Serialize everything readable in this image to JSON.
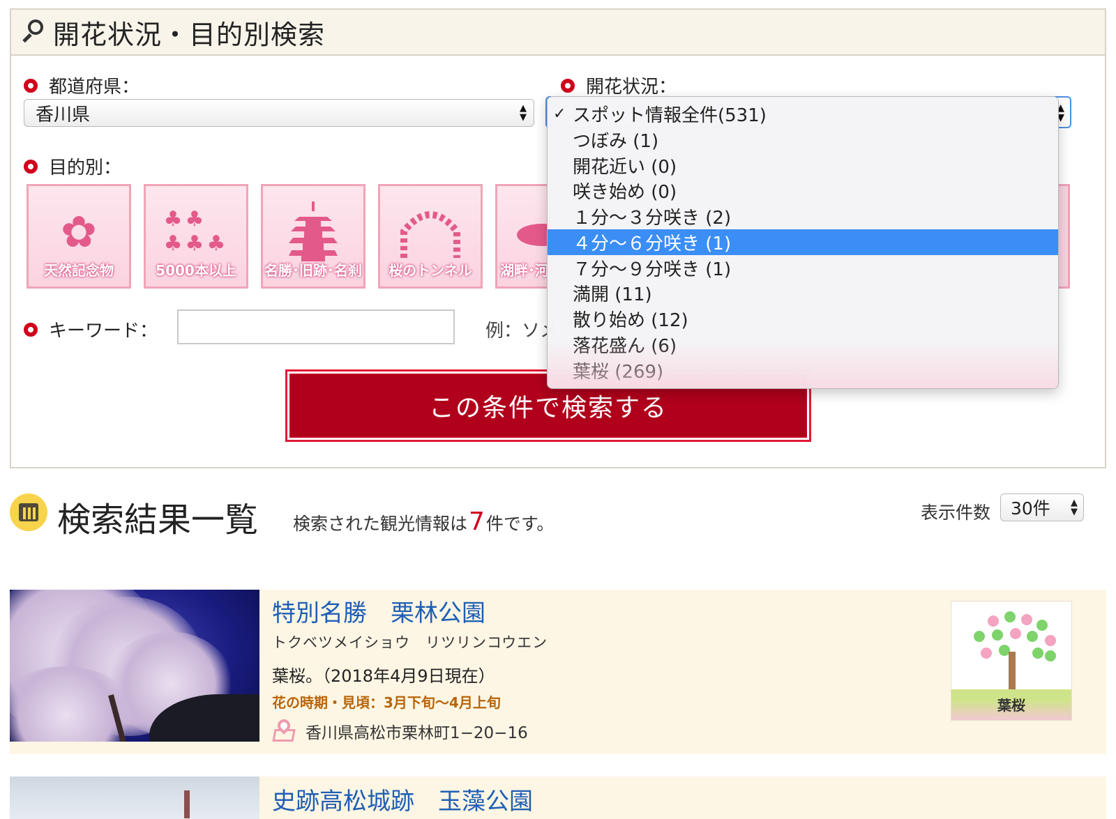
{
  "search_panel": {
    "title": "開花状況・目的別検索",
    "prefecture_label": "都道府県：",
    "prefecture_value": "香川県",
    "bloom_label": "開花状況：",
    "purpose_label": "目的別：",
    "purpose_tiles": [
      {
        "label": "天然記念物",
        "icon": "sakura-flower-icon"
      },
      {
        "label": "5000本以上",
        "icon": "tree-cluster-icon"
      },
      {
        "label": "名勝･旧跡･名刹",
        "icon": "pagoda-icon"
      },
      {
        "label": "桜のトンネル",
        "icon": "sakura-arch-icon"
      },
      {
        "label": "湖畔･河",
        "icon": "lakeside-icon"
      }
    ],
    "keyword_label": "キーワード：",
    "keyword_value": "",
    "keyword_example": "例：ソメ",
    "search_button": "この条件で検索する"
  },
  "bloom_dropdown": {
    "options": [
      {
        "label": "スポット情報全件(531)",
        "checked": true,
        "highlighted": false
      },
      {
        "label": "つぼみ (1)",
        "checked": false,
        "highlighted": false
      },
      {
        "label": "開花近い (0)",
        "checked": false,
        "highlighted": false
      },
      {
        "label": "咲き始め (0)",
        "checked": false,
        "highlighted": false
      },
      {
        "label": "１分～３分咲き (2)",
        "checked": false,
        "highlighted": false
      },
      {
        "label": "４分～６分咲き (1)",
        "checked": false,
        "highlighted": true
      },
      {
        "label": "７分～９分咲き (1)",
        "checked": false,
        "highlighted": false
      },
      {
        "label": "満開 (11)",
        "checked": false,
        "highlighted": false
      },
      {
        "label": "散り始め (12)",
        "checked": false,
        "highlighted": false
      },
      {
        "label": "落花盛ん (6)",
        "checked": false,
        "highlighted": false
      },
      {
        "label": "葉桜 (269)",
        "checked": false,
        "highlighted": false
      }
    ],
    "check_mark": "✓",
    "highlight_color": "#3b8ef5"
  },
  "results": {
    "title": "検索結果一覧",
    "count_prefix": "検索された観光情報は",
    "count": "7",
    "count_suffix": "件です。",
    "per_page_label": "表示件数",
    "per_page_value": "30件",
    "items": [
      {
        "title": "特別名勝　栗林公園",
        "kana": "トクベツメイショウ　リツリンコウエン",
        "status": "葉桜。（2018年4月9日現在）",
        "season": "花の時期・見頃：3月下旬〜4月上旬",
        "address": "香川県高松市栗林町1−20−16",
        "badge": "葉桜"
      },
      {
        "title": "史跡高松城跡　玉藻公園"
      }
    ]
  },
  "colors": {
    "accent_red": "#d0021b",
    "button_red": "#b1001c",
    "link_blue": "#1f5fb5",
    "card_bg": "#fdf6e4"
  }
}
